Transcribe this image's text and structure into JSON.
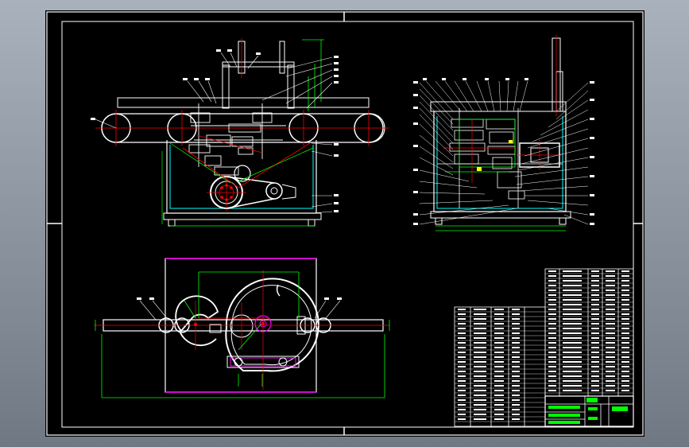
{
  "viewer": {
    "background": "#8a94a0",
    "background_top": "#a9b2bc",
    "background_bottom": "#6f7883"
  },
  "sheet": {
    "background": "#000000",
    "border_color": "#ffffff"
  },
  "palette": {
    "outline": "#ffffff",
    "dimension": "#00ff00",
    "center_line": "#ff0000",
    "hidden_part": "#00ffff",
    "boundary": "#ff00ff",
    "leader": "#ffffff"
  },
  "title_block": {
    "stamp_text": "",
    "school_text": ""
  }
}
